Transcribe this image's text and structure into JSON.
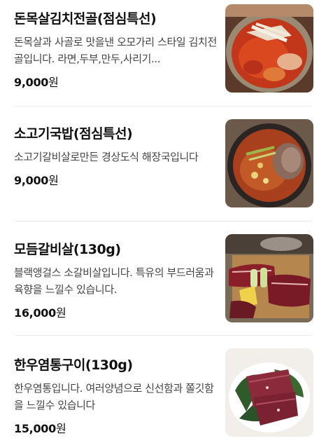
{
  "menu": {
    "items": [
      {
        "name": "돈목살김치전골(점심특선)",
        "description": "돈목살과 사골로 맛을낸 오모가리 스타일 김치전골입니다. 라면,두부,만두,사리기...",
        "price": "9,000",
        "currency": "원",
        "image": "kimchi-stew-photo"
      },
      {
        "name": "소고기국밥(점심특선)",
        "description": "소고기갈비살로만든 경상도식 해장국입니다",
        "price": "9,000",
        "currency": "원",
        "image": "beef-soup-photo"
      },
      {
        "name": "모듬갈비살(130g)",
        "description": "블랙앵걸스 소갈비살입니다. 특유의 부드러움과 육향을 느낄수 있습니다.",
        "price": "16,000",
        "currency": "원",
        "image": "assorted-rib-photo"
      },
      {
        "name": "한우염통구이(130g)",
        "description": "한우염통입니다. 여러양념으로 신선함과 쫄깃함을 느낄수 있습니다",
        "price": "15,000",
        "currency": "원",
        "image": "beef-heart-photo"
      }
    ]
  }
}
